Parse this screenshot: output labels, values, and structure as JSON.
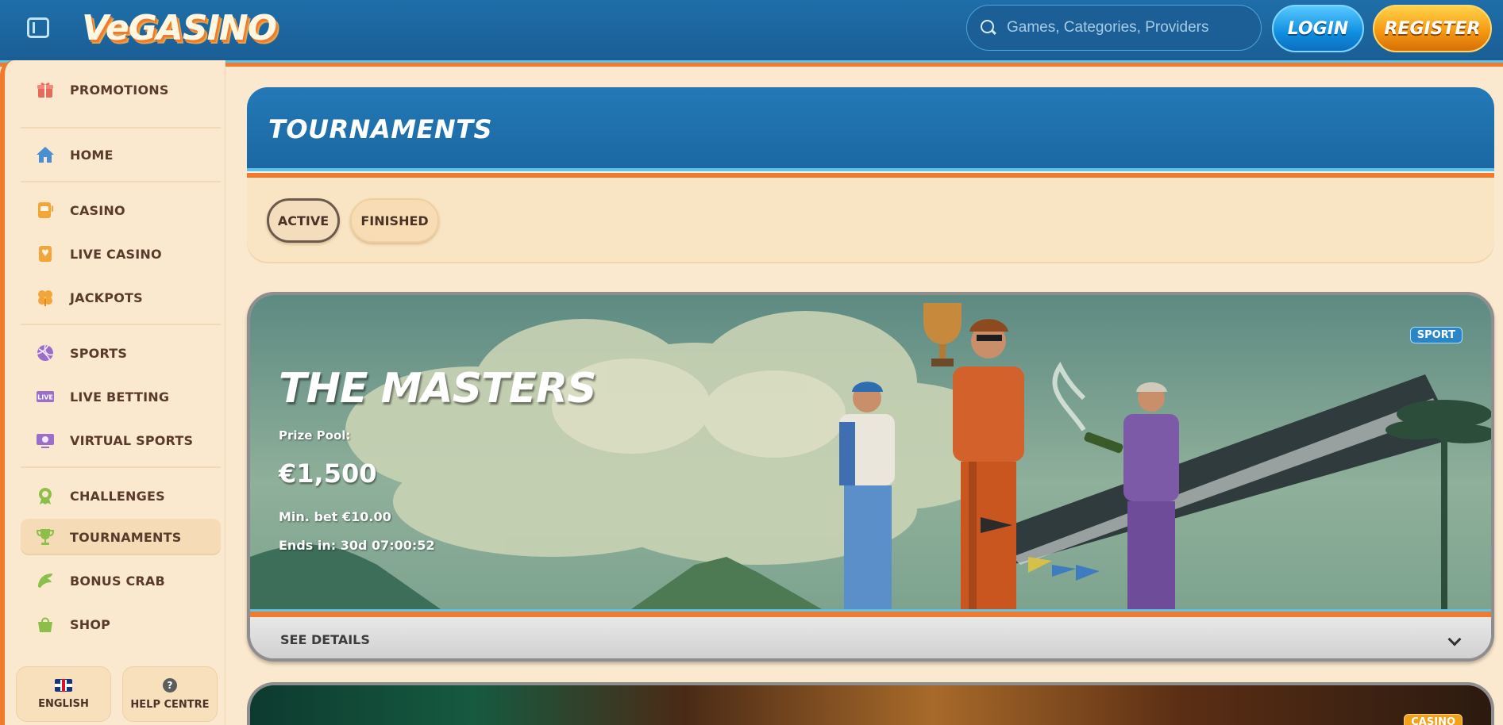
{
  "header": {
    "logo_text": "VeGASINO",
    "search_placeholder": "Games, Categories, Providers",
    "login_label": "LOGIN",
    "register_label": "REGISTER"
  },
  "sidebar": {
    "items": [
      {
        "label": "PROMOTIONS",
        "icon": "gift-icon"
      },
      {
        "label": "HOME",
        "icon": "home-icon"
      },
      {
        "label": "CASINO",
        "icon": "slot-machine-icon"
      },
      {
        "label": "LIVE CASINO",
        "icon": "playing-card-icon"
      },
      {
        "label": "JACKPOTS",
        "icon": "clover-icon"
      },
      {
        "label": "SPORTS",
        "icon": "ball-icon"
      },
      {
        "label": "LIVE BETTING",
        "icon": "live-icon"
      },
      {
        "label": "VIRTUAL SPORTS",
        "icon": "screen-icon"
      },
      {
        "label": "CHALLENGES",
        "icon": "medal-icon"
      },
      {
        "label": "TOURNAMENTS",
        "icon": "trophy-icon"
      },
      {
        "label": "BONUS CRAB",
        "icon": "claw-icon"
      },
      {
        "label": "SHOP",
        "icon": "bag-icon"
      }
    ],
    "active_item": "TOURNAMENTS",
    "language_label": "ENGLISH",
    "help_label": "HELP CENTRE"
  },
  "main": {
    "title": "TOURNAMENTS",
    "tabs": [
      {
        "label": "ACTIVE",
        "selected": true
      },
      {
        "label": "FINISHED",
        "selected": false
      }
    ]
  },
  "tournaments": [
    {
      "name": "THE MASTERS",
      "category_badge": "SPORT",
      "prize_pool_label": "Prize Pool:",
      "prize_pool": "€1,500",
      "min_bet": "Min. bet €10.00",
      "ends_in": "Ends in: 30d 07:00:52",
      "details_label": "SEE DETAILS"
    },
    {
      "category_badge": "CASINO"
    }
  ],
  "colors": {
    "header_blue": "#1f6ea9",
    "accent_orange": "#f07a2d",
    "accent_cyan": "#5ec3e8",
    "background_cream": "#fbe9cf",
    "login_blue": "#0f8ee0",
    "register_orange": "#f59a12"
  }
}
